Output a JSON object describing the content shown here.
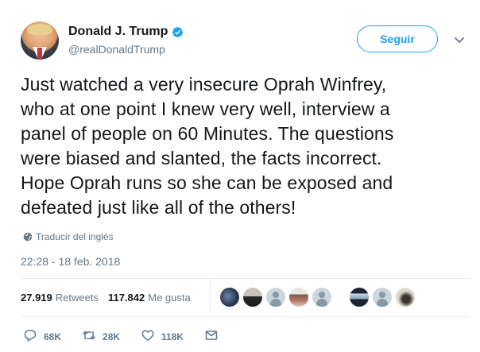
{
  "user": {
    "display_name": "Donald J. Trump",
    "handle": "@realDonaldTrump",
    "verified": true
  },
  "follow_button_label": "Seguir",
  "tweet": {
    "text_lines": [
      "Just watched a very insecure Oprah Winfrey,",
      "who at one point I knew very well, interview a",
      "panel of people on 60 Minutes. The questions",
      "were biased and slanted, the facts incorrect.",
      "Hope Oprah runs so she can be exposed and",
      "defeated just like all of the others!"
    ],
    "translate_label": "Traducir del inglés",
    "timestamp": "22:28 - 18 feb. 2018"
  },
  "stats": {
    "retweets_count": "27.919",
    "retweets_label": "Retweets",
    "likes_count": "117.842",
    "likes_label": "Me gusta"
  },
  "actions": {
    "replies": "68K",
    "retweets": "28K",
    "likes": "118K"
  },
  "colors": {
    "accent": "#1da1f2",
    "secondary_text": "#657786",
    "divider": "#e6ecf0"
  }
}
